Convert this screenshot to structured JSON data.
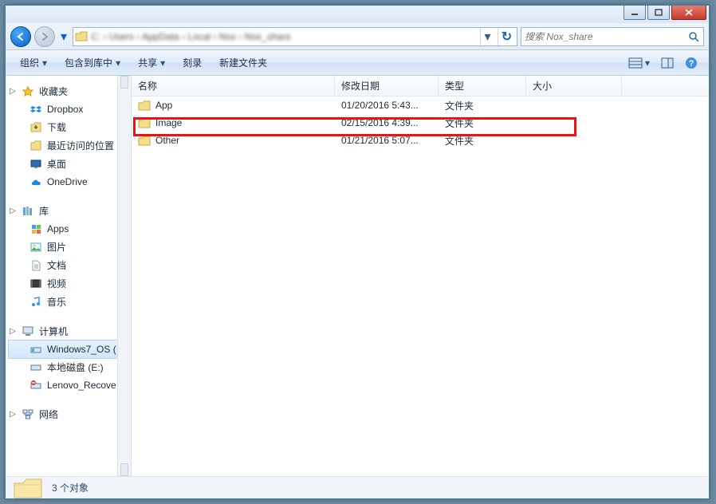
{
  "titlebar": {
    "min": "–",
    "max": "▢",
    "close": "✕"
  },
  "nav": {
    "back": "←",
    "forward": "→"
  },
  "address": {
    "path": "C: › Users › AppData › Local › Nox › Nox_share",
    "dropdown": "▾",
    "refresh": "↻"
  },
  "search": {
    "placeholder": "搜索 Nox_share"
  },
  "toolbar": {
    "organize": "组织",
    "include": "包含到库中",
    "share": "共享",
    "burn": "刻录",
    "newfolder": "新建文件夹"
  },
  "sidebar": {
    "favorites": {
      "label": "收藏夹",
      "items": [
        {
          "icon": "dropbox",
          "label": "Dropbox"
        },
        {
          "icon": "download",
          "label": "下载"
        },
        {
          "icon": "recent",
          "label": "最近访问的位置"
        },
        {
          "icon": "desktop",
          "label": "桌面"
        },
        {
          "icon": "onedrive",
          "label": "OneDrive"
        }
      ]
    },
    "libraries": {
      "label": "库",
      "items": [
        {
          "icon": "apps",
          "label": "Apps"
        },
        {
          "icon": "pictures",
          "label": "图片"
        },
        {
          "icon": "documents",
          "label": "文档"
        },
        {
          "icon": "videos",
          "label": "视频"
        },
        {
          "icon": "music",
          "label": "音乐"
        }
      ]
    },
    "computer": {
      "label": "计算机",
      "items": [
        {
          "icon": "drive",
          "label": "Windows7_OS (",
          "selected": true
        },
        {
          "icon": "drive",
          "label": "本地磁盘 (E:)"
        },
        {
          "icon": "drive-warn",
          "label": "Lenovo_Recove"
        }
      ]
    },
    "network": {
      "label": "网络"
    }
  },
  "columns": {
    "name": "名称",
    "date": "修改日期",
    "type": "类型",
    "size": "大小"
  },
  "rows": [
    {
      "name": "App",
      "date": "01/20/2016 5:43...",
      "type": "文件夹"
    },
    {
      "name": "Image",
      "date": "02/15/2016 4:39...",
      "type": "文件夹"
    },
    {
      "name": "Other",
      "date": "01/21/2016 5:07...",
      "type": "文件夹"
    }
  ],
  "status": {
    "count": "3 个对象"
  }
}
